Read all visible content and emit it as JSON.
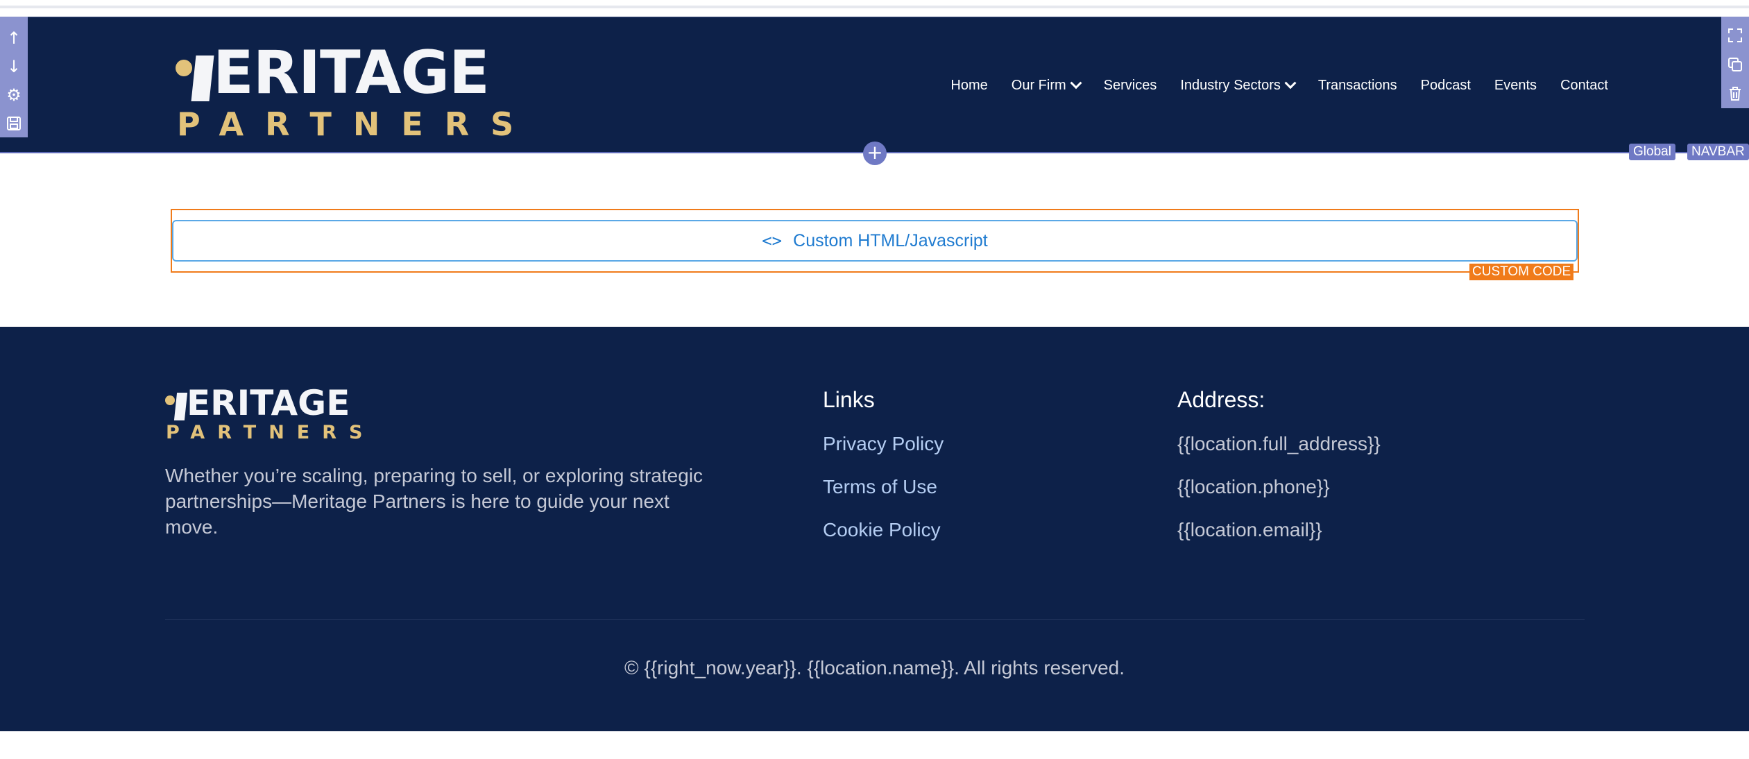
{
  "navbar": {
    "logo_top": "MERITAGE",
    "logo_top_rest": "ERITAGE",
    "logo_bottom": "PARTNERS",
    "items": [
      {
        "label": "Home",
        "has_dropdown": false
      },
      {
        "label": "Our Firm",
        "has_dropdown": true
      },
      {
        "label": "Services",
        "has_dropdown": false
      },
      {
        "label": "Industry Sectors",
        "has_dropdown": true
      },
      {
        "label": "Transactions",
        "has_dropdown": false
      },
      {
        "label": "Podcast",
        "has_dropdown": false
      },
      {
        "label": "Events",
        "has_dropdown": false
      },
      {
        "label": "Contact",
        "has_dropdown": false
      }
    ]
  },
  "editor": {
    "left_tools": [
      "arrow-up-icon",
      "arrow-down-icon",
      "gear-icon",
      "save-icon"
    ],
    "right_tools": [
      "expand-icon",
      "duplicate-icon",
      "trash-icon"
    ],
    "tags": {
      "global": "Global",
      "navbar": "NAVBAR",
      "custom_code": "CUSTOM CODE"
    },
    "custom_code_label": "Custom HTML/Javascript",
    "accent": "#6f79c4",
    "custom_code_color": "#f07b1a"
  },
  "footer": {
    "logo_top_rest": "ERITAGE",
    "logo_bottom": "PARTNERS",
    "description": "Whether you’re scaling, preparing to sell, or exploring strategic partnerships—Meritage Partners is here to guide your next move.",
    "links_heading": "Links",
    "links": [
      "Privacy Policy",
      "Terms of Use",
      "Cookie Policy"
    ],
    "address_heading": "Address:",
    "address_lines": [
      "{{location.full_address}}",
      "{{location.phone}}",
      "{{location.email}}"
    ],
    "copyright": "© {{right_now.year}}. {{location.name}}. All rights reserved.",
    "bg_color": "#0d2149",
    "gold": "#e2c27a"
  }
}
